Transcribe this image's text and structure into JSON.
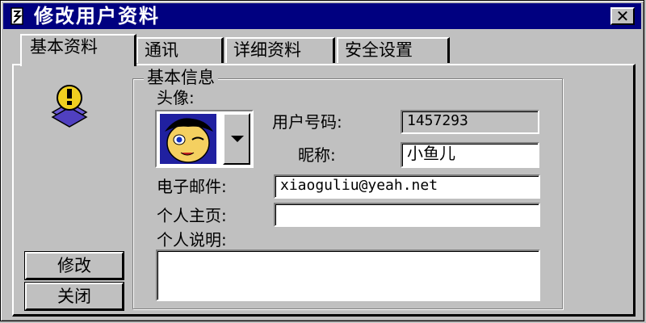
{
  "window": {
    "title": "修改用户资料",
    "close_label": "✕"
  },
  "tabs": [
    {
      "label": "基本资料",
      "active": true
    },
    {
      "label": "通讯",
      "active": false
    },
    {
      "label": "详细资料",
      "active": false
    },
    {
      "label": "安全设置",
      "active": false
    }
  ],
  "basic_info": {
    "group_title": "基本信息",
    "avatar_label": "头像:",
    "user_number_label": "用户号码:",
    "user_number_value": "1457293",
    "nickname_label": "昵称:",
    "nickname_value": "小鱼儿",
    "email_label": "电子邮件:",
    "email_value": "xiaoguliu@yeah.net",
    "homepage_label": "个人主页:",
    "homepage_value": "",
    "description_label": "个人说明:",
    "description_value": ""
  },
  "buttons": {
    "modify_label": "修改",
    "close_label": "关闭"
  },
  "icons": {
    "title_icon": "app-icon",
    "user_icon": "user-info-icon",
    "dropdown_icon": "chevron-down-icon"
  },
  "colors": {
    "titlebar": "#000080",
    "window_bg": "#c0c0c0"
  }
}
